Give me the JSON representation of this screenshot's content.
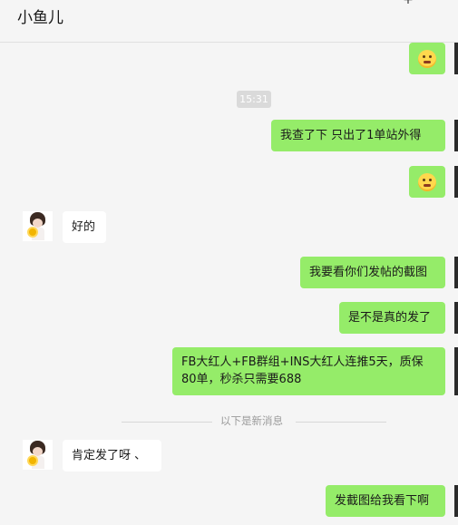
{
  "header": {
    "title": "小鱼儿",
    "more_icon_glyph": "+"
  },
  "timestamp": "15:31",
  "divider_label": "以下是新消息",
  "messages": [
    {
      "direction": "outgoing",
      "type": "emoji",
      "emoji": "shy-face"
    },
    {
      "direction": "outgoing",
      "text": "我查了下  只出了1单站外得"
    },
    {
      "direction": "outgoing",
      "type": "emoji",
      "emoji": "shy-face"
    },
    {
      "direction": "incoming",
      "text": "好的"
    },
    {
      "direction": "outgoing",
      "text": "我要看你们发帖的截图"
    },
    {
      "direction": "outgoing",
      "text": "是不是真的发了"
    },
    {
      "direction": "outgoing",
      "line1": "FB大红人+FB群组+INS大红人连推5天，质保",
      "line2": "80单，秒杀只需要688"
    },
    {
      "direction": "incoming",
      "text": "肯定发了呀 、"
    },
    {
      "direction": "outgoing",
      "text": "发截图给我看下啊"
    }
  ],
  "colors": {
    "outgoing_bubble": "#95ec69",
    "incoming_bubble": "#ffffff",
    "background": "#f5f5f5"
  }
}
